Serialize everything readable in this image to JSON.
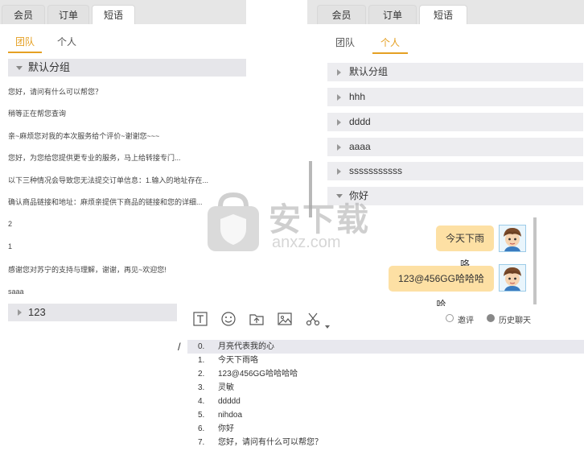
{
  "left_panel": {
    "tabs": [
      "会员",
      "订单",
      "短语"
    ],
    "subtabs": [
      "团队",
      "个人"
    ],
    "default_group": "默认分组",
    "phrases": [
      "您好，请问有什么可以帮您？",
      "稍等正在帮您查询",
      "亲~麻烦您对我的本次服务给个评价~谢谢您~~~",
      "您好，为您给您提供更专业的服务，马上给转接专门...",
      "以下三种情况会导致您无法提交订单信息：1.输入的地址存在...",
      "确认商品链接和地址：麻烦亲提供下商品的链接和您的详细...",
      "2",
      "1",
      "感谢您对苏宁的支持与理解，谢谢，再见~欢迎您!",
      "saaa"
    ],
    "group_123": "123"
  },
  "right_panel": {
    "tabs": [
      "会员",
      "订单",
      "短语"
    ],
    "subtabs": [
      "团队",
      "个人"
    ],
    "groups": [
      "默认分组",
      "hhh",
      "dddd",
      "aaaa",
      "sssssssssss",
      "你好"
    ],
    "messages": [
      "今天下雨咯",
      "123@456GG哈哈哈哈"
    ]
  },
  "toolbar": {
    "rate_label": "邀评",
    "history_label": "历史聊天"
  },
  "slash_char": "/",
  "suggestions": [
    {
      "num": "0.",
      "text": "月亮代表我的心"
    },
    {
      "num": "1.",
      "text": "今天下雨咯"
    },
    {
      "num": "2.",
      "text": "123@456GG哈哈哈哈"
    },
    {
      "num": "3.",
      "text": "灵敏"
    },
    {
      "num": "4.",
      "text": "ddddd"
    },
    {
      "num": "5.",
      "text": "nihdoa"
    },
    {
      "num": "6.",
      "text": "你好"
    },
    {
      "num": "7.",
      "text": "您好，请问有什么可以帮您？"
    }
  ],
  "watermark": {
    "text": "安下载",
    "sub": "anxz.com"
  }
}
